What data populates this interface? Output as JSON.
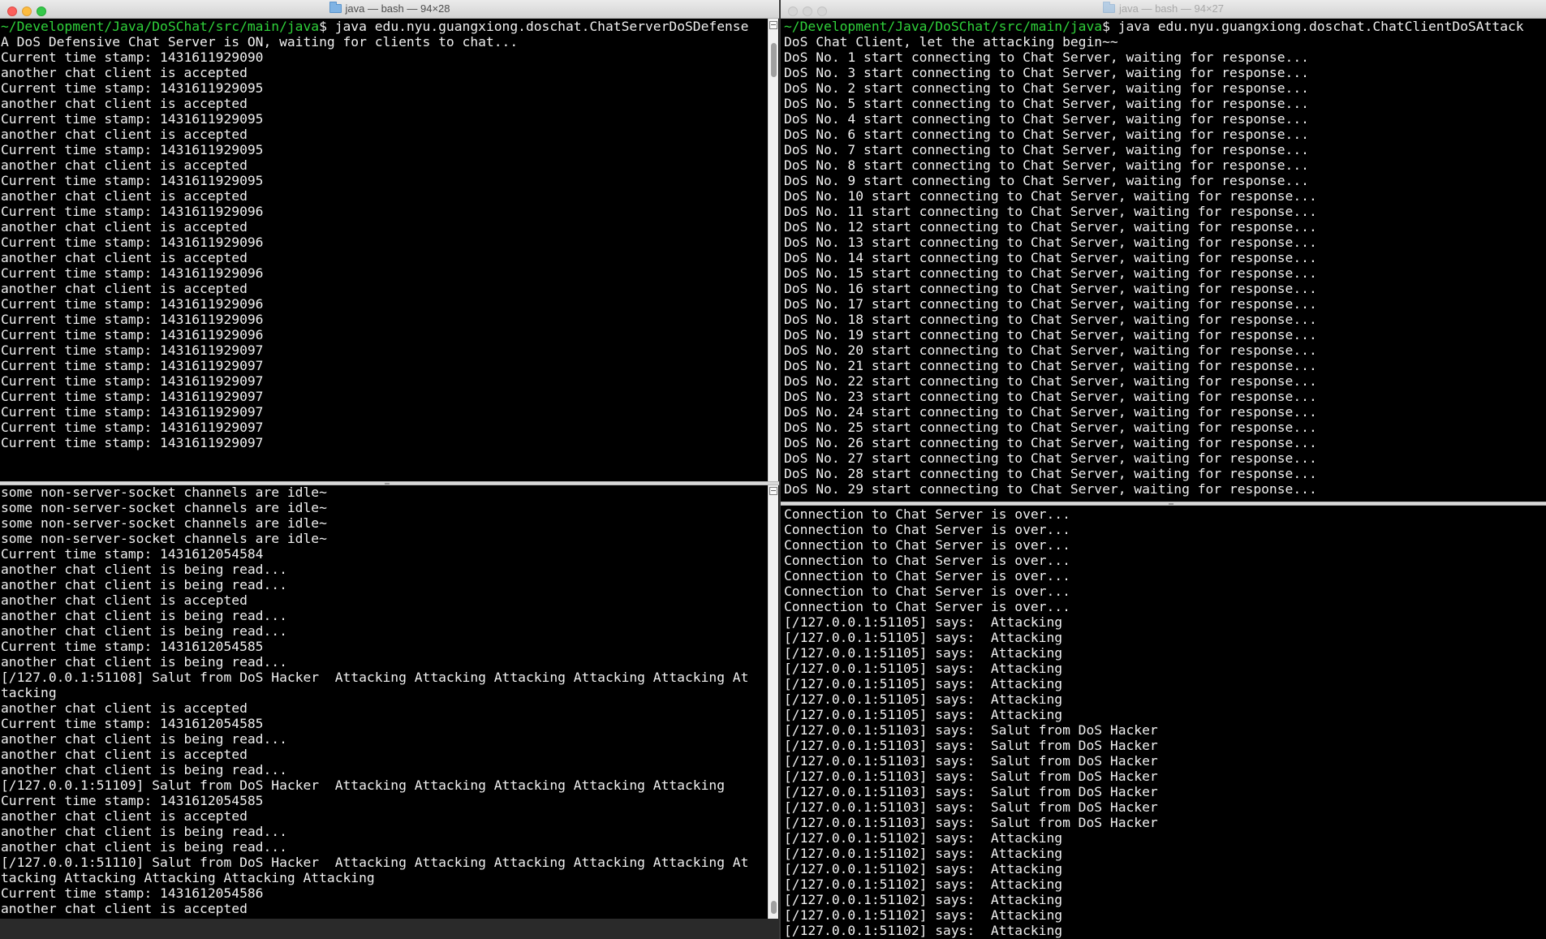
{
  "left_window": {
    "title": "java — bash — 94×28",
    "top_pane": {
      "prompt_path": "~/Development/Java/DoSChat/src/main/java",
      "prompt_cmd": "$ java edu.nyu.guangxiong.doschat.ChatServerDoSDefense",
      "lines": [
        "A DoS Defensive Chat Server is ON, waiting for clients to chat...",
        "Current time stamp: 1431611929090",
        "another chat client is accepted",
        "Current time stamp: 1431611929095",
        "another chat client is accepted",
        "Current time stamp: 1431611929095",
        "another chat client is accepted",
        "Current time stamp: 1431611929095",
        "another chat client is accepted",
        "Current time stamp: 1431611929095",
        "another chat client is accepted",
        "Current time stamp: 1431611929096",
        "another chat client is accepted",
        "Current time stamp: 1431611929096",
        "another chat client is accepted",
        "Current time stamp: 1431611929096",
        "another chat client is accepted",
        "Current time stamp: 1431611929096",
        "Current time stamp: 1431611929096",
        "Current time stamp: 1431611929096",
        "Current time stamp: 1431611929097",
        "Current time stamp: 1431611929097",
        "Current time stamp: 1431611929097",
        "Current time stamp: 1431611929097",
        "Current time stamp: 1431611929097",
        "Current time stamp: 1431611929097",
        "Current time stamp: 1431611929097"
      ]
    },
    "bottom_pane": {
      "lines": [
        "some non-server-socket channels are idle~",
        "some non-server-socket channels are idle~",
        "some non-server-socket channels are idle~",
        "some non-server-socket channels are idle~",
        "Current time stamp: 1431612054584",
        "another chat client is being read...",
        "another chat client is being read...",
        "another chat client is accepted",
        "another chat client is being read...",
        "another chat client is being read...",
        "Current time stamp: 1431612054585",
        "another chat client is being read...",
        "[/127.0.0.1:51108] Salut from DoS Hacker  Attacking Attacking Attacking Attacking Attacking At",
        "tacking",
        "another chat client is accepted",
        "Current time stamp: 1431612054585",
        "another chat client is being read...",
        "another chat client is accepted",
        "another chat client is being read...",
        "[/127.0.0.1:51109] Salut from DoS Hacker  Attacking Attacking Attacking Attacking Attacking",
        "Current time stamp: 1431612054585",
        "another chat client is accepted",
        "another chat client is being read...",
        "another chat client is being read...",
        "[/127.0.0.1:51110] Salut from DoS Hacker  Attacking Attacking Attacking Attacking Attacking At",
        "tacking Attacking Attacking Attacking Attacking",
        "Current time stamp: 1431612054586",
        "another chat client is accepted"
      ]
    }
  },
  "right_window": {
    "title": "java — bash — 94×27",
    "top_pane": {
      "prompt_path": "~/Development/Java/DoSChat/src/main/java",
      "prompt_cmd": "$ java edu.nyu.guangxiong.doschat.ChatClientDoSAttack",
      "lines": [
        "DoS Chat Client, let the attacking begin~~",
        "DoS No. 1 start connecting to Chat Server, waiting for response...",
        "DoS No. 3 start connecting to Chat Server, waiting for response...",
        "DoS No. 2 start connecting to Chat Server, waiting for response...",
        "DoS No. 5 start connecting to Chat Server, waiting for response...",
        "DoS No. 4 start connecting to Chat Server, waiting for response...",
        "DoS No. 6 start connecting to Chat Server, waiting for response...",
        "DoS No. 7 start connecting to Chat Server, waiting for response...",
        "DoS No. 8 start connecting to Chat Server, waiting for response...",
        "DoS No. 9 start connecting to Chat Server, waiting for response...",
        "DoS No. 10 start connecting to Chat Server, waiting for response...",
        "DoS No. 11 start connecting to Chat Server, waiting for response...",
        "DoS No. 12 start connecting to Chat Server, waiting for response...",
        "DoS No. 13 start connecting to Chat Server, waiting for response...",
        "DoS No. 14 start connecting to Chat Server, waiting for response...",
        "DoS No. 15 start connecting to Chat Server, waiting for response...",
        "DoS No. 16 start connecting to Chat Server, waiting for response...",
        "DoS No. 17 start connecting to Chat Server, waiting for response...",
        "DoS No. 18 start connecting to Chat Server, waiting for response...",
        "DoS No. 19 start connecting to Chat Server, waiting for response...",
        "DoS No. 20 start connecting to Chat Server, waiting for response...",
        "DoS No. 21 start connecting to Chat Server, waiting for response...",
        "DoS No. 22 start connecting to Chat Server, waiting for response...",
        "DoS No. 23 start connecting to Chat Server, waiting for response...",
        "DoS No. 24 start connecting to Chat Server, waiting for response...",
        "DoS No. 25 start connecting to Chat Server, waiting for response...",
        "DoS No. 26 start connecting to Chat Server, waiting for response...",
        "DoS No. 27 start connecting to Chat Server, waiting for response...",
        "DoS No. 28 start connecting to Chat Server, waiting for response...",
        "DoS No. 29 start connecting to Chat Server, waiting for response..."
      ]
    },
    "bottom_pane": {
      "lines": [
        "Connection to Chat Server is over...",
        "Connection to Chat Server is over...",
        "Connection to Chat Server is over...",
        "Connection to Chat Server is over...",
        "Connection to Chat Server is over...",
        "Connection to Chat Server is over...",
        "Connection to Chat Server is over...",
        "[/127.0.0.1:51105] says:  Attacking",
        "[/127.0.0.1:51105] says:  Attacking",
        "[/127.0.0.1:51105] says:  Attacking",
        "[/127.0.0.1:51105] says:  Attacking",
        "[/127.0.0.1:51105] says:  Attacking",
        "[/127.0.0.1:51105] says:  Attacking",
        "[/127.0.0.1:51105] says:  Attacking",
        "[/127.0.0.1:51103] says:  Salut from DoS Hacker",
        "[/127.0.0.1:51103] says:  Salut from DoS Hacker",
        "[/127.0.0.1:51103] says:  Salut from DoS Hacker",
        "[/127.0.0.1:51103] says:  Salut from DoS Hacker",
        "[/127.0.0.1:51103] says:  Salut from DoS Hacker",
        "[/127.0.0.1:51103] says:  Salut from DoS Hacker",
        "[/127.0.0.1:51103] says:  Salut from DoS Hacker",
        "[/127.0.0.1:51102] says:  Attacking",
        "[/127.0.0.1:51102] says:  Attacking",
        "[/127.0.0.1:51102] says:  Attacking",
        "[/127.0.0.1:51102] says:  Attacking",
        "[/127.0.0.1:51102] says:  Attacking",
        "[/127.0.0.1:51102] says:  Attacking",
        "[/127.0.0.1:51102] says:  Attacking"
      ]
    }
  },
  "colors": {
    "terminal_bg": "#000000",
    "terminal_fg": "#f0f0f0",
    "prompt_path": "#2fd13a"
  },
  "icons": [
    "folder-icon",
    "close-icon",
    "minimize-icon",
    "zoom-icon",
    "split-pane-icon"
  ]
}
